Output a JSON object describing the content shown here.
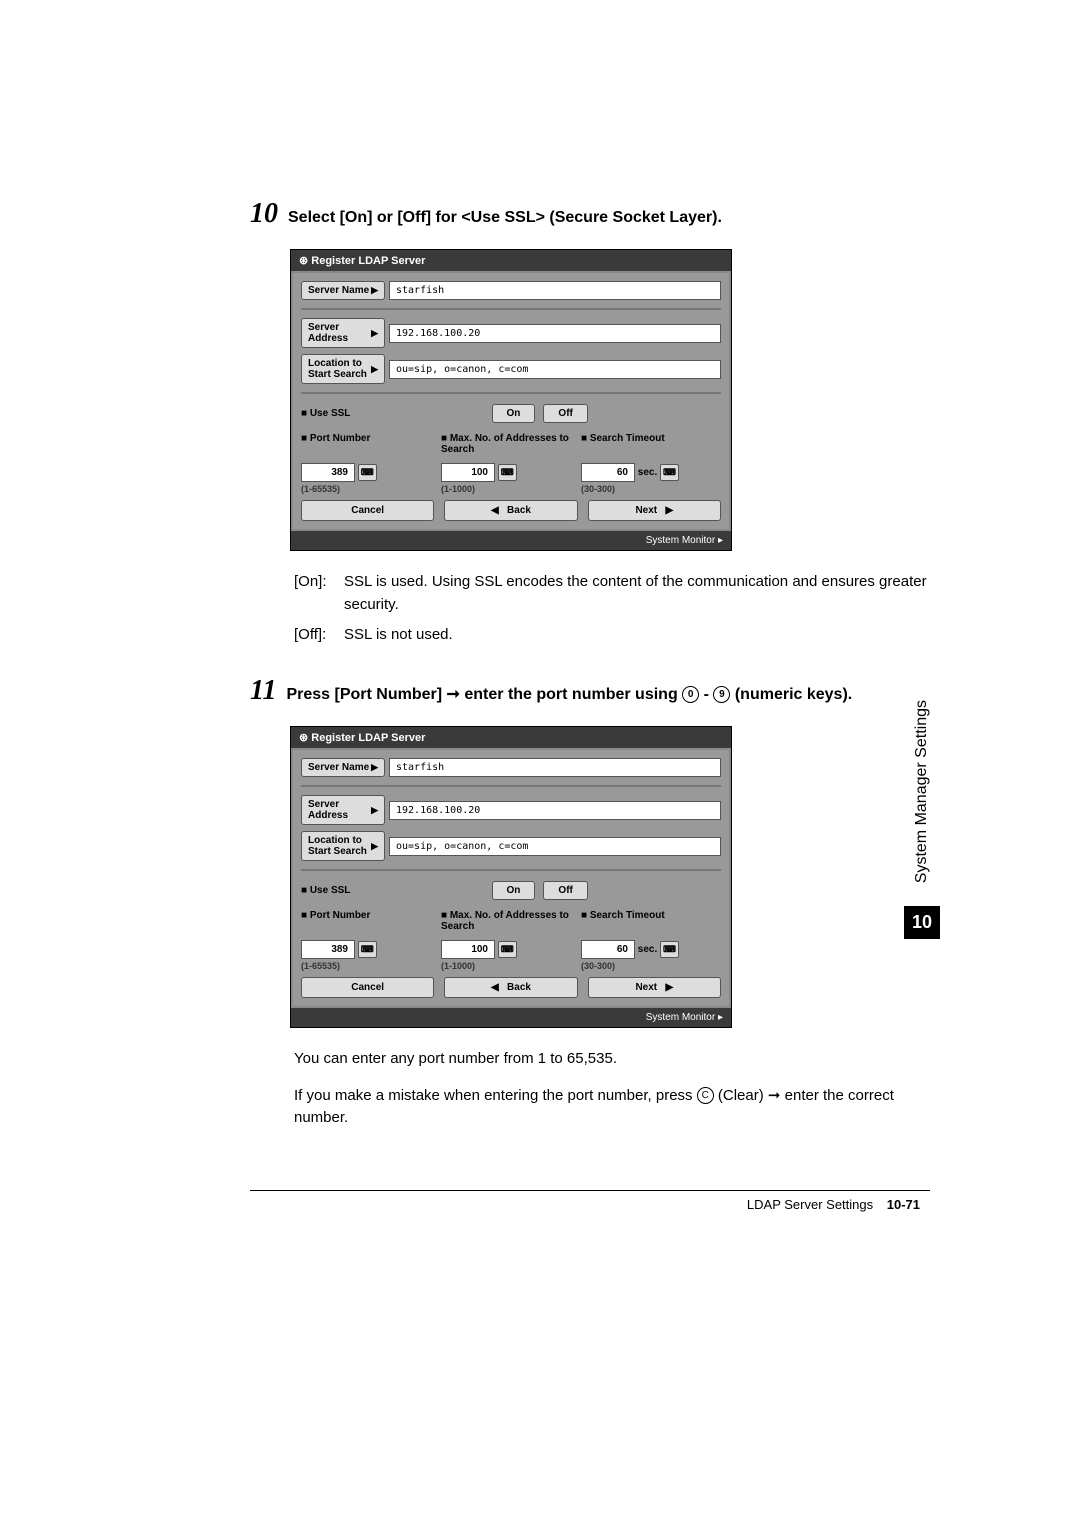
{
  "steps": {
    "s10": {
      "num": "10",
      "text": "Select [On] or [Off] for <Use SSL> (Secure Socket Layer).",
      "desc": [
        {
          "key": "[On]:",
          "val": "SSL is used. Using SSL encodes the content of the communication and ensures greater security."
        },
        {
          "key": "[Off]:",
          "val": "SSL is not used."
        }
      ]
    },
    "s11": {
      "num": "11",
      "text_a": "Press [Port Number] ",
      "arrow": "➞",
      "text_b": " enter the port number using ",
      "key0": "0",
      "dash": " - ",
      "key9": "9",
      "text_c": " (numeric keys).",
      "body1": "You can enter any port number from 1 to 65,535.",
      "body2a": "If you make a mistake when entering the port number, press ",
      "keyC": "C",
      "body2b": " (Clear) ",
      "body2c": " enter the correct number."
    }
  },
  "screenshot": {
    "title": "Register LDAP Server",
    "server_name_label": "Server Name",
    "server_name_val": "starfish",
    "server_addr_label": "Server Address",
    "server_addr_val": "192.168.100.20",
    "location_label": "Location to Start Search",
    "location_val": "ou=sip, o=canon, c=com",
    "use_ssl_label": "■ Use SSL",
    "on": "On",
    "off": "Off",
    "port_label": "■ Port Number",
    "max_label": "■ Max. No. of Addresses to Search",
    "timeout_label": "■ Search Timeout",
    "port_val": "389",
    "port_range": "(1-65535)",
    "max_val": "100",
    "max_range": "(1-1000)",
    "timeout_val": "60",
    "timeout_unit": "sec.",
    "timeout_range": "(30-300)",
    "cancel": "Cancel",
    "back": "Back",
    "next": "Next",
    "sysmon": "System Monitor"
  },
  "side": {
    "label": "System Manager Settings",
    "chap": "10"
  },
  "footer": {
    "section": "LDAP Server Settings",
    "page": "10-71"
  }
}
